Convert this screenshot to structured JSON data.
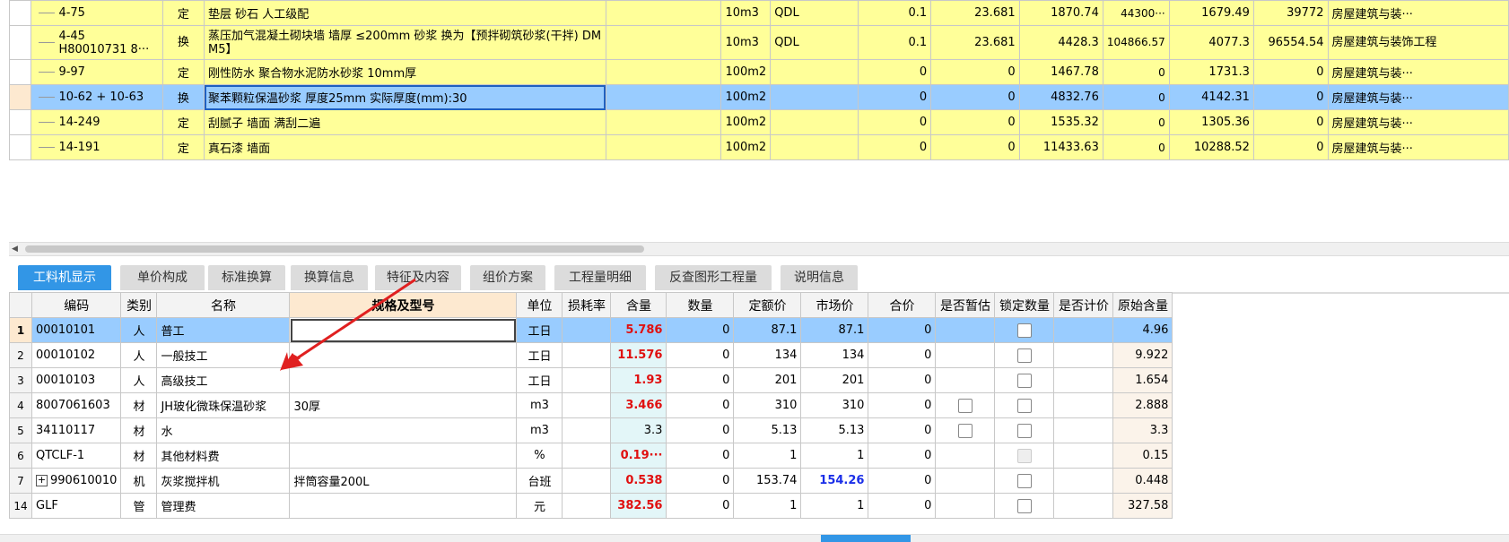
{
  "upper_rows": [
    {
      "code": "4-75",
      "type": "定",
      "name": "垫层 砂石 人工级配",
      "unit": "10m3",
      "q1": "QDL",
      "q2": "0.1",
      "q3": "23.681",
      "q4": "1870.74",
      "q5": "44300···",
      "q6": "1679.49",
      "q7": "39772",
      "q8": "房屋建筑与装···",
      "state": "normal"
    },
    {
      "code": "4-45\nH80010731 8···",
      "type": "换",
      "name": "蒸压加气混凝土砌块墙 墙厚 ≤200mm 砂浆  换为【预拌砌筑砂浆(干拌) DM M5】",
      "unit": "10m3",
      "q1": "QDL",
      "q2": "0.1",
      "q3": "23.681",
      "q4": "4428.3",
      "q5": "104866.57",
      "q6": "4077.3",
      "q7": "96554.54",
      "q8": "房屋建筑与装饰工程",
      "state": "tall"
    },
    {
      "code": "9-97",
      "type": "定",
      "name": "刚性防水 聚合物水泥防水砂浆 10mm厚",
      "unit": "100m2",
      "q1": "",
      "q2": "0",
      "q3": "0",
      "q4": "1467.78",
      "q5": "0",
      "q6": "1731.3",
      "q7": "0",
      "q8": "房屋建筑与装···",
      "state": "normal"
    },
    {
      "code": "10-62 + 10-63",
      "type": "换",
      "name": "聚苯颗粒保温砂浆 厚度25mm  实际厚度(mm):30",
      "unit": "100m2",
      "q1": "",
      "q2": "0",
      "q3": "0",
      "q4": "4832.76",
      "q5": "0",
      "q6": "4142.31",
      "q7": "0",
      "q8": "房屋建筑与装···",
      "state": "sel"
    },
    {
      "code": "14-249",
      "type": "定",
      "name": "刮腻子 墙面 满刮二遍",
      "unit": "100m2",
      "q1": "",
      "q2": "0",
      "q3": "0",
      "q4": "1535.32",
      "q5": "0",
      "q6": "1305.36",
      "q7": "0",
      "q8": "房屋建筑与装···",
      "state": "normal"
    },
    {
      "code": "14-191",
      "type": "定",
      "name": "真石漆 墙面",
      "unit": "100m2",
      "q1": "",
      "q2": "0",
      "q3": "0",
      "q4": "11433.63",
      "q5": "0",
      "q6": "10288.52",
      "q7": "0",
      "q8": "房屋建筑与装···",
      "state": "normal"
    }
  ],
  "tabs": [
    "工料机显示",
    "单价构成",
    "标准换算",
    "换算信息",
    "特征及内容",
    "组价方案",
    "工程量明细",
    "反查图形工程量",
    "说明信息"
  ],
  "active_tab": 0,
  "lower_headers": [
    "",
    "编码",
    "类别",
    "名称",
    "规格及型号",
    "单位",
    "损耗率",
    "含量",
    "数量",
    "定额价",
    "市场价",
    "合价",
    "是否暂估",
    "锁定数量",
    "是否计价",
    "原始含量"
  ],
  "lower_rows": [
    {
      "rn": "1",
      "code": "00010101",
      "cat": "人",
      "name": "普工",
      "spec": "",
      "unit": "工日",
      "loss": "",
      "qty": "5.786",
      "num": "0",
      "price": "87.1",
      "market": "87.1",
      "total": "0",
      "est": "",
      "lock": "cb",
      "calc": "",
      "orig": "4.96"
    },
    {
      "rn": "2",
      "code": "00010102",
      "cat": "人",
      "name": "一般技工",
      "spec": "",
      "unit": "工日",
      "loss": "",
      "qty": "11.576",
      "num": "0",
      "price": "134",
      "market": "134",
      "total": "0",
      "est": "",
      "lock": "cb",
      "calc": "",
      "orig": "9.922"
    },
    {
      "rn": "3",
      "code": "00010103",
      "cat": "人",
      "name": "高级技工",
      "spec": "",
      "unit": "工日",
      "loss": "",
      "qty": "1.93",
      "num": "0",
      "price": "201",
      "market": "201",
      "total": "0",
      "est": "",
      "lock": "cb",
      "calc": "",
      "orig": "1.654"
    },
    {
      "rn": "4",
      "code": "8007061603",
      "cat": "材",
      "name": "JH玻化微珠保温砂浆",
      "spec": "30厚",
      "unit": "m3",
      "loss": "",
      "qty": "3.466",
      "num": "0",
      "price": "310",
      "market": "310",
      "total": "0",
      "est": "cb",
      "lock": "cb",
      "calc": "",
      "orig": "2.888"
    },
    {
      "rn": "5",
      "code": "34110117",
      "cat": "材",
      "name": "水",
      "spec": "",
      "unit": "m3",
      "loss": "",
      "qty": "3.3",
      "num": "0",
      "price": "5.13",
      "market": "5.13",
      "total": "0",
      "est": "cb",
      "lock": "cb",
      "calc": "",
      "orig": "3.3"
    },
    {
      "rn": "6",
      "code": "QTCLF-1",
      "cat": "材",
      "name": "其他材料费",
      "spec": "",
      "unit": "%",
      "loss": "",
      "qty": "0.19···",
      "num": "0",
      "price": "1",
      "market": "1",
      "total": "0",
      "est": "",
      "lock": "dis",
      "calc": "",
      "orig": "0.15"
    },
    {
      "rn": "7",
      "code": "990610010",
      "cat": "机",
      "name": "灰浆搅拌机",
      "spec": "拌筒容量200L",
      "unit": "台班",
      "loss": "",
      "qty": "0.538",
      "num": "0",
      "price": "153.74",
      "market": "154.26",
      "total": "0",
      "est": "",
      "lock": "cb",
      "calc": "",
      "orig": "0.448"
    },
    {
      "rn": "14",
      "code": "GLF",
      "cat": "管",
      "name": "管理费",
      "spec": "",
      "unit": "元",
      "loss": "",
      "qty": "382.56",
      "num": "0",
      "price": "1",
      "market": "1",
      "total": "0",
      "est": "",
      "lock": "cb",
      "calc": "",
      "orig": "327.58"
    }
  ],
  "colors": {
    "accent": "#3296e6",
    "selected_row": "#99ccff",
    "yellow_row": "#ffff99",
    "qty_red": "#e01010",
    "market_blue": "#1a2ee8",
    "annotation_arrow": "#e02020"
  }
}
